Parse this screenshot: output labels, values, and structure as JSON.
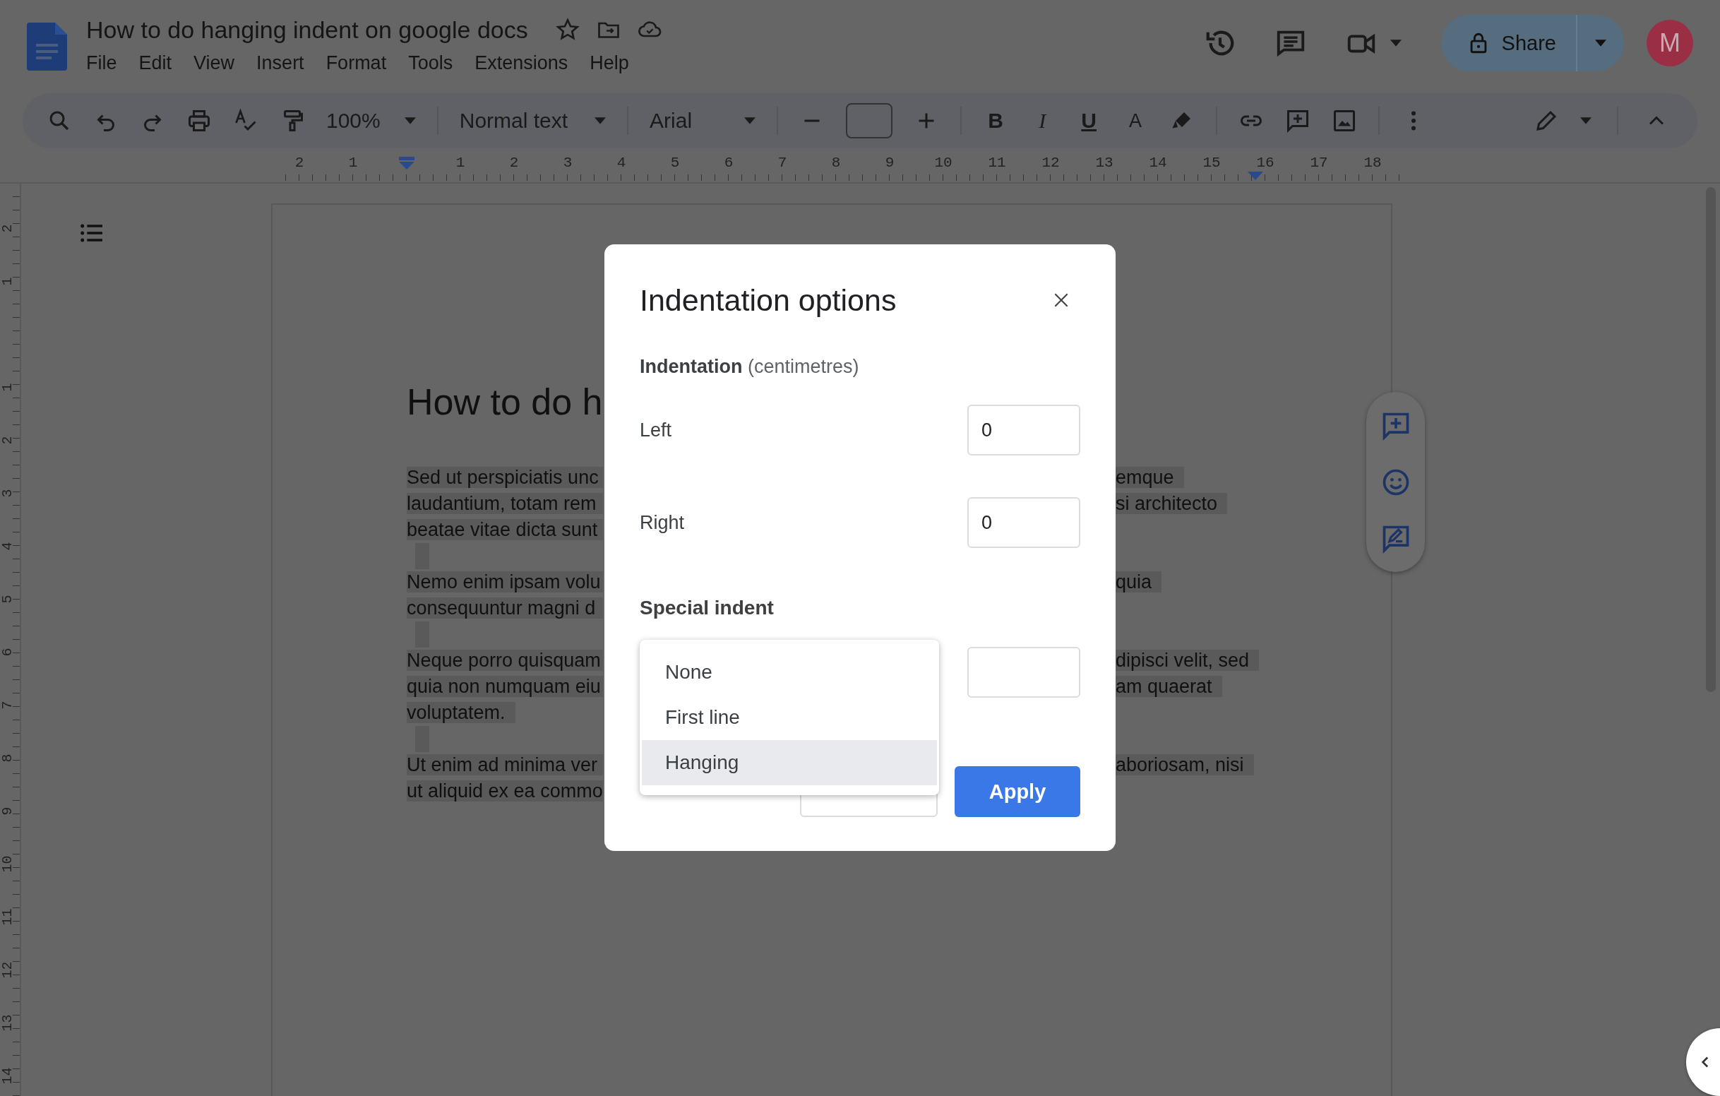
{
  "header": {
    "title": "How to do hanging indent on google docs",
    "menu": [
      "File",
      "Edit",
      "View",
      "Insert",
      "Format",
      "Tools",
      "Extensions",
      "Help"
    ],
    "share": "Share",
    "avatar": "M"
  },
  "toolbar": {
    "zoom": "100%",
    "style": "Normal text",
    "font": "Arial",
    "format_buttons": [
      "B",
      "I",
      "U",
      "A"
    ]
  },
  "ruler": {
    "h_before": [
      "2",
      "1"
    ],
    "h_after": [
      "1",
      "2",
      "3",
      "4",
      "5",
      "6",
      "7",
      "8",
      "9",
      "10",
      "11",
      "12",
      "13",
      "14",
      "15",
      "16",
      "17",
      "18"
    ],
    "v_before": [
      "2",
      "1"
    ],
    "v_after": [
      "1",
      "2",
      "3",
      "4",
      "5",
      "6",
      "7",
      "8",
      "9",
      "10",
      "11",
      "12",
      "13",
      "14"
    ]
  },
  "document": {
    "heading": "How to do h",
    "paragraphs": [
      {
        "lines": [
          {
            "left": "Sed ut perspiciatis unc",
            "right": "emque"
          },
          {
            "left": "laudantium, totam rem",
            "right": "si architecto"
          },
          {
            "left": "beatae vitae dicta sunt"
          }
        ]
      },
      {
        "lines": [
          {
            "left": "Nemo enim ipsam volu",
            "right": "quia"
          },
          {
            "left": "consequuntur magni d"
          }
        ]
      },
      {
        "lines": [
          {
            "left": "Neque porro quisquam",
            "right": "dipisci velit, sed"
          },
          {
            "left": "quia non numquam eiu",
            "right": "am quaerat"
          },
          {
            "left": "voluptatem."
          }
        ]
      },
      {
        "lines": [
          {
            "left": "Ut enim ad minima ver",
            "right": "aboriosam, nisi"
          },
          {
            "left": "ut aliquid ex ea commo"
          }
        ]
      }
    ]
  },
  "dialog": {
    "title": "Indentation options",
    "section": "**Indentation** (centimetres)",
    "fields": [
      {
        "label": "Left",
        "value": "0"
      },
      {
        "label": "Right",
        "value": "0"
      }
    ],
    "special_label": "Special indent",
    "special_options": [
      {
        "label": "None",
        "selected": false
      },
      {
        "label": "First line",
        "selected": false
      },
      {
        "label": "Hanging",
        "selected": true
      }
    ],
    "apply": "Apply"
  }
}
